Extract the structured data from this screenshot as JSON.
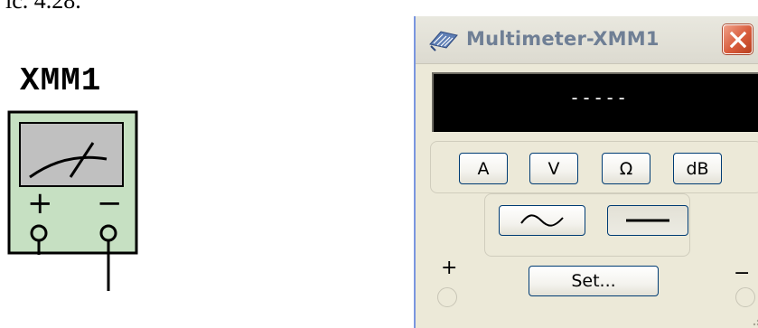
{
  "caption": {
    "text": "iс. 4.28."
  },
  "symbol": {
    "name": "XMM1",
    "plus": "+",
    "minus": "−",
    "colors": {
      "body": "#c6e0c2",
      "face": "#c0c0c0"
    }
  },
  "window": {
    "title": "Multimeter-XMM1",
    "icon": "multimeter-icon",
    "display_value": "-----",
    "buttons": {
      "ammeter": "A",
      "voltmeter": "V",
      "ohmmeter": "Ω",
      "decibel": "dB",
      "set": "Set..."
    },
    "signal_buttons": {
      "ac": "ac-wave-icon",
      "dc": "dc-line-icon",
      "selected": "dc"
    },
    "terminals": {
      "plus": "+",
      "minus": "−"
    },
    "colors": {
      "title_text": "#6f7f95",
      "close": "#d85c3c",
      "panel": "#ece9d8",
      "display_bg": "#000000"
    }
  }
}
